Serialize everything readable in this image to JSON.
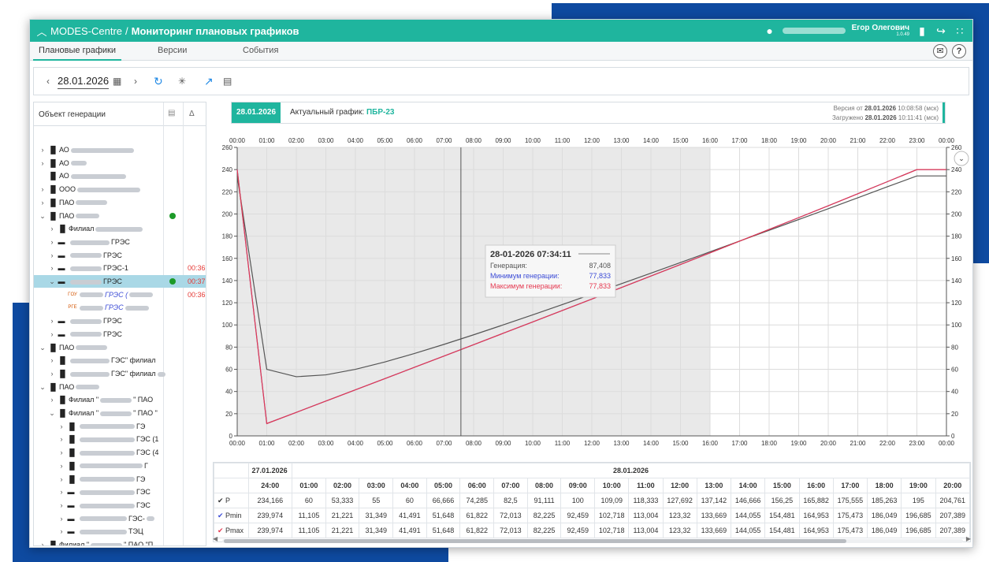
{
  "app": {
    "title": "MODES-Centre",
    "separator": "/",
    "page_title": "Мониторинг плановых графиков"
  },
  "user": {
    "name": "Егор Олегович",
    "version": "1.0.49"
  },
  "tabs": [
    {
      "label": "Плановые графики",
      "active": true
    },
    {
      "label": "Версии"
    },
    {
      "label": "События"
    }
  ],
  "toolbar": {
    "date": "28.01.2026"
  },
  "left_panel": {
    "header": {
      "object": "Объект генерации",
      "delta": "Δ"
    },
    "rows": [
      {
        "label": "АО",
        "blur_before": 0,
        "blur_after": 80,
        "arrow": ">",
        "icon": "plant",
        "depth": 0
      },
      {
        "label": "АО",
        "blur_before": 0,
        "blur_after": 20,
        "arrow": ">",
        "icon": "plant",
        "depth": 0
      },
      {
        "label": "АО",
        "blur_before": 0,
        "blur_after": 70,
        "arrow": "",
        "icon": "plant",
        "depth": 0
      },
      {
        "label": "ООО",
        "blur_before": 0,
        "blur_after": 80,
        "arrow": ">",
        "icon": "plant",
        "depth": 0
      },
      {
        "label": "ПАО",
        "blur_before": 0,
        "blur_after": 40,
        "arrow": ">",
        "icon": "plant",
        "depth": 0
      },
      {
        "label": "ПАО",
        "blur_before": 0,
        "blur_after": 30,
        "arrow": "v",
        "icon": "plant",
        "depth": 0,
        "dot": true
      },
      {
        "label": "Филиал",
        "blur_before": 0,
        "blur_after": 60,
        "arrow": ">",
        "icon": "plant",
        "depth": 1
      },
      {
        "label": "ГРЭС",
        "blur_before": 50,
        "blur_after": 0,
        "arrow": ">",
        "icon": "block",
        "depth": 1
      },
      {
        "label": "ГРЭС",
        "blur_before": 40,
        "blur_after": 0,
        "arrow": ">",
        "icon": "block",
        "depth": 1
      },
      {
        "label": "ГРЭС-1",
        "blur_before": 40,
        "blur_after": 0,
        "arrow": ">",
        "icon": "block",
        "depth": 1,
        "time": "00:36"
      },
      {
        "label": "ГРЭС",
        "blur_before": 40,
        "blur_after": 0,
        "arrow": "v",
        "icon": "block",
        "depth": 1,
        "dot": true,
        "time": "00:37",
        "selected": true
      },
      {
        "label": "ГРЭС (",
        "blur_before": 30,
        "blur_after": 30,
        "arrow": "",
        "icon": "gou",
        "depth": 2,
        "italic": true,
        "time": "00:36"
      },
      {
        "label": "ГРЭС",
        "blur_before": 30,
        "blur_after": 30,
        "arrow": "",
        "icon": "rge",
        "depth": 2,
        "italic": true
      },
      {
        "label": "ГРЭС",
        "blur_before": 40,
        "blur_after": 0,
        "arrow": ">",
        "icon": "block",
        "depth": 1
      },
      {
        "label": "ГРЭС",
        "blur_before": 40,
        "blur_after": 0,
        "arrow": ">",
        "icon": "block",
        "depth": 1
      },
      {
        "label": "ПАО",
        "blur_before": 0,
        "blur_after": 40,
        "arrow": "v",
        "icon": "plant",
        "depth": 0
      },
      {
        "label": "ГЭС\" филиал",
        "blur_before": 50,
        "blur_after": 0,
        "arrow": ">",
        "icon": "plant",
        "depth": 1
      },
      {
        "label": "ГЭС\" филиал",
        "blur_before": 50,
        "blur_after": 10,
        "arrow": ">",
        "icon": "plant",
        "depth": 1
      },
      {
        "label": "ПАО",
        "blur_before": 0,
        "blur_after": 30,
        "arrow": "v",
        "icon": "plant",
        "depth": 0
      },
      {
        "label": "Филиал \"",
        "blur_before": 0,
        "blur_after": 40,
        "arrow": ">",
        "icon": "plant",
        "depth": 1,
        "suffix": "\" ПАО"
      },
      {
        "label": "Филиал \"",
        "blur_before": 0,
        "blur_after": 40,
        "arrow": "v",
        "icon": "plant",
        "depth": 1,
        "suffix": "\" ПАО \""
      },
      {
        "label": "ГЭ",
        "blur_before": 70,
        "blur_after": 0,
        "arrow": ">",
        "icon": "plant",
        "depth": 2
      },
      {
        "label": "ГЭС (1",
        "blur_before": 70,
        "blur_after": 0,
        "arrow": ">",
        "icon": "plant",
        "depth": 2
      },
      {
        "label": "ГЭС (4",
        "blur_before": 70,
        "blur_after": 0,
        "arrow": ">",
        "icon": "plant",
        "depth": 2
      },
      {
        "label": "Г",
        "blur_before": 80,
        "blur_after": 0,
        "arrow": ">",
        "icon": "plant",
        "depth": 2
      },
      {
        "label": "ГЭ",
        "blur_before": 70,
        "blur_after": 0,
        "arrow": ">",
        "icon": "plant",
        "depth": 2
      },
      {
        "label": "ГЭС",
        "blur_before": 70,
        "blur_after": 0,
        "arrow": ">",
        "icon": "block",
        "depth": 2
      },
      {
        "label": "ГЭС",
        "blur_before": 70,
        "blur_after": 0,
        "arrow": ">",
        "icon": "block",
        "depth": 2
      },
      {
        "label": "ГЭС-",
        "blur_before": 60,
        "blur_after": 10,
        "arrow": ">",
        "icon": "block",
        "depth": 2
      },
      {
        "label": "ТЭЦ",
        "blur_before": 60,
        "blur_after": 0,
        "arrow": ">",
        "icon": "block",
        "depth": 2
      },
      {
        "label": "Филиал \"",
        "blur_before": 0,
        "blur_after": 40,
        "arrow": ">",
        "icon": "plant",
        "depth": 0,
        "suffix": "\" ПАО \"П"
      }
    ]
  },
  "info_bar": {
    "date": "28.01.2026",
    "actual_label": "Актуальный график:",
    "actual_value": "ПБР-23",
    "version_label": "Версия от",
    "version_date": "28.01.2026",
    "version_time": "10:08:58 (мск)",
    "loaded_label": "Загружено",
    "loaded_date": "28.01.2026",
    "loaded_time": "10:11:41 (мск)"
  },
  "chart_data": {
    "type": "line",
    "x": [
      "00:00",
      "01:00",
      "02:00",
      "03:00",
      "04:00",
      "05:00",
      "06:00",
      "07:00",
      "08:00",
      "09:00",
      "10:00",
      "11:00",
      "12:00",
      "13:00",
      "14:00",
      "15:00",
      "16:00",
      "17:00",
      "18:00",
      "19:00",
      "20:00",
      "21:00",
      "22:00",
      "23:00",
      "00:00"
    ],
    "ylim": [
      0,
      260
    ],
    "yticks": [
      0,
      20,
      40,
      60,
      80,
      100,
      120,
      140,
      160,
      180,
      200,
      220,
      240,
      260
    ],
    "series": [
      {
        "key": "P",
        "color": "#555555",
        "values": [
          234.166,
          60,
          53.333,
          55,
          60,
          66.666,
          74.285,
          82.5,
          91.111,
          100,
          109.09,
          118.333,
          127.692,
          137.142,
          146.666,
          156.25,
          165.882,
          175.555,
          185.263,
          195,
          204.761,
          214.6,
          224.5,
          234.3,
          234.3
        ]
      },
      {
        "key": "Pmin",
        "color": "#3b4bd6",
        "values": [
          239.974,
          11.105,
          21.221,
          31.349,
          41.491,
          51.648,
          61.822,
          72.013,
          82.225,
          92.459,
          102.718,
          113.004,
          123.32,
          133.669,
          144.055,
          154.481,
          164.953,
          175.473,
          186.049,
          196.685,
          207.389,
          218.2,
          229.1,
          240.0,
          240.0
        ]
      },
      {
        "key": "Pmax",
        "color": "#e53950",
        "values": [
          239.974,
          11.105,
          21.221,
          31.349,
          41.491,
          51.648,
          61.822,
          72.013,
          82.225,
          92.459,
          102.718,
          113.004,
          123.32,
          133.669,
          144.055,
          154.481,
          164.953,
          175.473,
          186.049,
          196.685,
          207.389,
          218.2,
          229.1,
          240.0,
          240.0
        ]
      }
    ],
    "shaded_until_hour": 16,
    "cursor_hour": 7.57,
    "tooltip": {
      "title": "28-01-2026 07:34:11",
      "rows": [
        {
          "label": "Генерация:",
          "value": "87,408",
          "color": "#555555"
        },
        {
          "label": "Минимум генерации:",
          "value": "77,833",
          "color": "#3b4bd6"
        },
        {
          "label": "Максимум генерации:",
          "value": "77,833",
          "color": "#e53950"
        }
      ]
    }
  },
  "table": {
    "date1": "27.01.2026",
    "date2": "28.01.2026",
    "hours": [
      "24:00",
      "01:00",
      "02:00",
      "03:00",
      "04:00",
      "05:00",
      "06:00",
      "07:00",
      "08:00",
      "09:00",
      "10:00",
      "11:00",
      "12:00",
      "13:00",
      "14:00",
      "15:00",
      "16:00",
      "17:00",
      "18:00",
      "19:00",
      "20:00"
    ],
    "rows": [
      {
        "label": "P",
        "color": "#333333",
        "values": [
          "234,166",
          "60",
          "53,333",
          "55",
          "60",
          "66,666",
          "74,285",
          "82,5",
          "91,111",
          "100",
          "109,09",
          "118,333",
          "127,692",
          "137,142",
          "146,666",
          "156,25",
          "165,882",
          "175,555",
          "185,263",
          "195",
          "204,761"
        ]
      },
      {
        "label": "Pmin",
        "color": "#3b4bd6",
        "values": [
          "239,974",
          "11,105",
          "21,221",
          "31,349",
          "41,491",
          "51,648",
          "61,822",
          "72,013",
          "82,225",
          "92,459",
          "102,718",
          "113,004",
          "123,32",
          "133,669",
          "144,055",
          "154,481",
          "164,953",
          "175,473",
          "186,049",
          "196,685",
          "207,389"
        ]
      },
      {
        "label": "Pmax",
        "color": "#e53950",
        "values": [
          "239,974",
          "11,105",
          "21,221",
          "31,349",
          "41,491",
          "51,648",
          "61,822",
          "72,013",
          "82,225",
          "92,459",
          "102,718",
          "113,004",
          "123,32",
          "133,669",
          "144,055",
          "154,481",
          "164,953",
          "175,473",
          "186,049",
          "196,685",
          "207,389"
        ]
      }
    ]
  }
}
